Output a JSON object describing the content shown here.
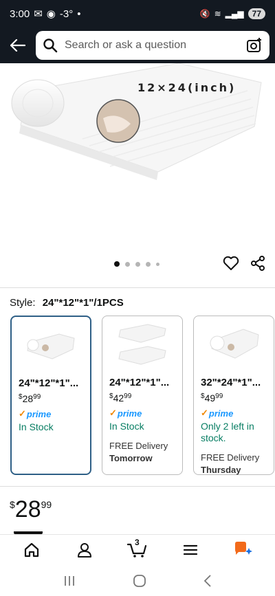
{
  "status": {
    "time": "3:00",
    "temp": "-3°",
    "battery": "77"
  },
  "search": {
    "placeholder": "Search or ask a question"
  },
  "hero": {
    "caption": "12×24(inch)"
  },
  "style": {
    "label": "Style:",
    "value": "24\"*12\"*1\"/1PCS"
  },
  "variants": [
    {
      "name": "24\"*12\"*1\"...",
      "price_dollars": "28",
      "price_cents": "99",
      "prime": "prime",
      "stock": "In Stock",
      "delivery": "",
      "delivery_day": "",
      "selected": true
    },
    {
      "name": "24\"*12\"*1\"...",
      "price_dollars": "42",
      "price_cents": "99",
      "prime": "prime",
      "stock": "In Stock",
      "delivery": "FREE Delivery",
      "delivery_day": "Tomorrow",
      "selected": false
    },
    {
      "name": "32\"*24\"*1\"...",
      "price_dollars": "49",
      "price_cents": "99",
      "prime": "prime",
      "stock": "Only 2 left in stock.",
      "delivery": "FREE Delivery",
      "delivery_day": "Thursday",
      "selected": false
    }
  ],
  "price": {
    "currency": "$",
    "dollars": "28",
    "cents": "99"
  },
  "nav": {
    "cart_count": "3"
  },
  "colors": {
    "header": "#131921",
    "stock_green": "#067d62",
    "prime_blue": "#1a98ff",
    "selected_border": "#2e5f86"
  }
}
